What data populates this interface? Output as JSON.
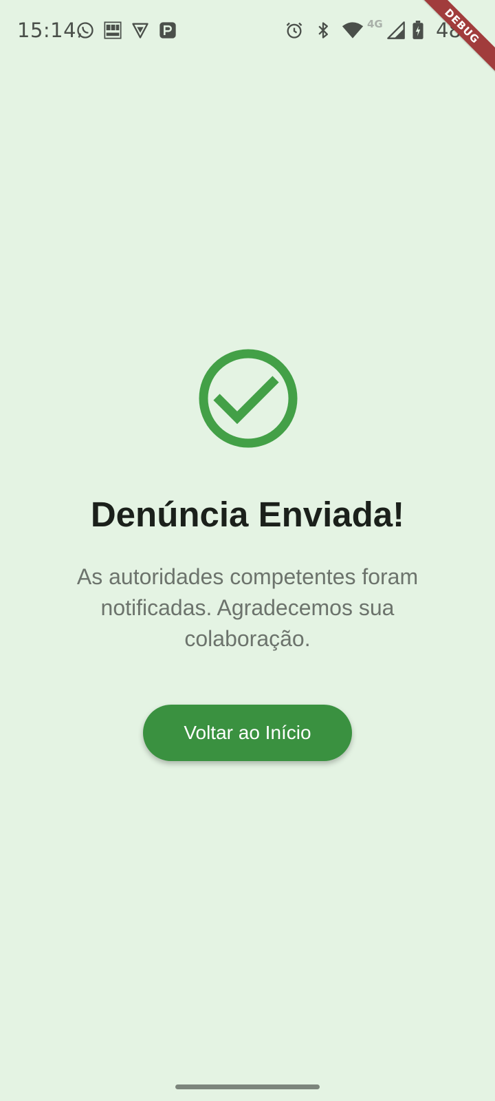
{
  "status_bar": {
    "time": "15:14",
    "battery": "48",
    "network": "4G"
  },
  "debug_banner": "DEBUG",
  "success": {
    "title": "Denúncia Enviada!",
    "message": "As autoridades competentes foram notificadas. Agradecemos sua colaboração.",
    "button_label": "Voltar ao Início"
  },
  "colors": {
    "background": "#e4f3e3",
    "accent": "#43a047",
    "button": "#3a9140",
    "debug": "#a13c3c"
  },
  "icons": {
    "success": "check-circle-icon"
  }
}
